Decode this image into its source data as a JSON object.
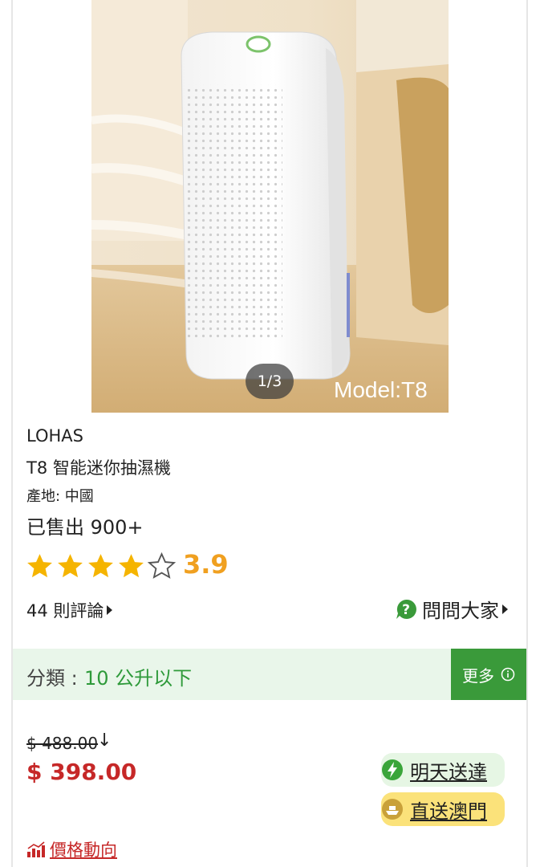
{
  "product": {
    "image_counter": "1/3",
    "image_model_text": "Model:T8",
    "brand": "LOHAS",
    "name": "T8 智能迷你抽濕機",
    "origin": "產地: 中國",
    "sold": "已售出 900+",
    "rating": "3.9",
    "rating_value": 3.9,
    "stars_filled": 4,
    "stars_total": 5,
    "reviews": "44 則評論",
    "ask": "問問大家"
  },
  "category": {
    "label": "分類 :",
    "value": "10 公升以下",
    "more": "更多"
  },
  "price": {
    "original": "$ 488.00",
    "down_arrow": "↓",
    "current": "$ 398.00"
  },
  "delivery": {
    "tomorrow": "明天送達",
    "macau": "直送澳門"
  },
  "trend": {
    "label": "價格動向"
  },
  "colors": {
    "accent_green": "#3a9a3a",
    "category_green": "#2e9a3a",
    "price_red": "#c62828",
    "star_gold": "#f5b400",
    "rating_orange": "#f0a020",
    "macau_yellow": "#fbe27a"
  },
  "icons": {
    "ask": "question-bubble-icon",
    "more": "info-icon",
    "tomorrow": "lightning-icon",
    "macau": "ship-icon",
    "trend": "bar-chart-icon"
  }
}
